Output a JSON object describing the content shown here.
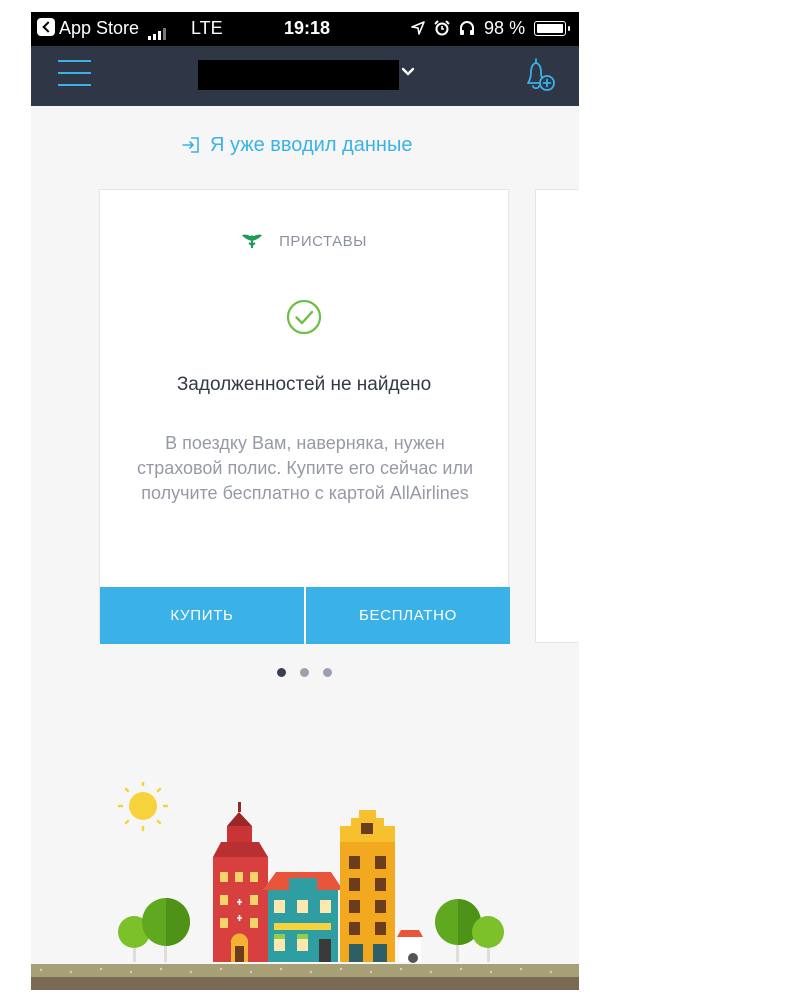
{
  "status_bar": {
    "back_app": "App Store",
    "carrier": "LTE",
    "time": "19:18",
    "battery": "98 %"
  },
  "nav": {
    "menu_icon": "hamburger-menu-icon",
    "dropdown_icon": "chevron-down-icon",
    "bell_icon": "bell-plus-icon"
  },
  "login_link": {
    "icon": "sign-in-icon",
    "label": "Я уже вводил данные"
  },
  "card": {
    "source_icon": "emblem-icon",
    "source": "ПРИСТАВЫ",
    "status_icon": "check-circle-icon",
    "title": "Задолженностей не найдено",
    "body": "В поездку Вам, наверняка, нужен страховой полис. Купите его сейчас или получите бесплатно с картой AllAirlines",
    "buy_label": "КУПИТЬ",
    "free_label": "БЕСПЛАТНО"
  },
  "pagination": {
    "total": 3,
    "active": 1
  },
  "colors": {
    "accent": "#3ab2e8",
    "navbar": "#2f3645",
    "success": "#6cbf3f",
    "background": "#f6f6f6"
  }
}
